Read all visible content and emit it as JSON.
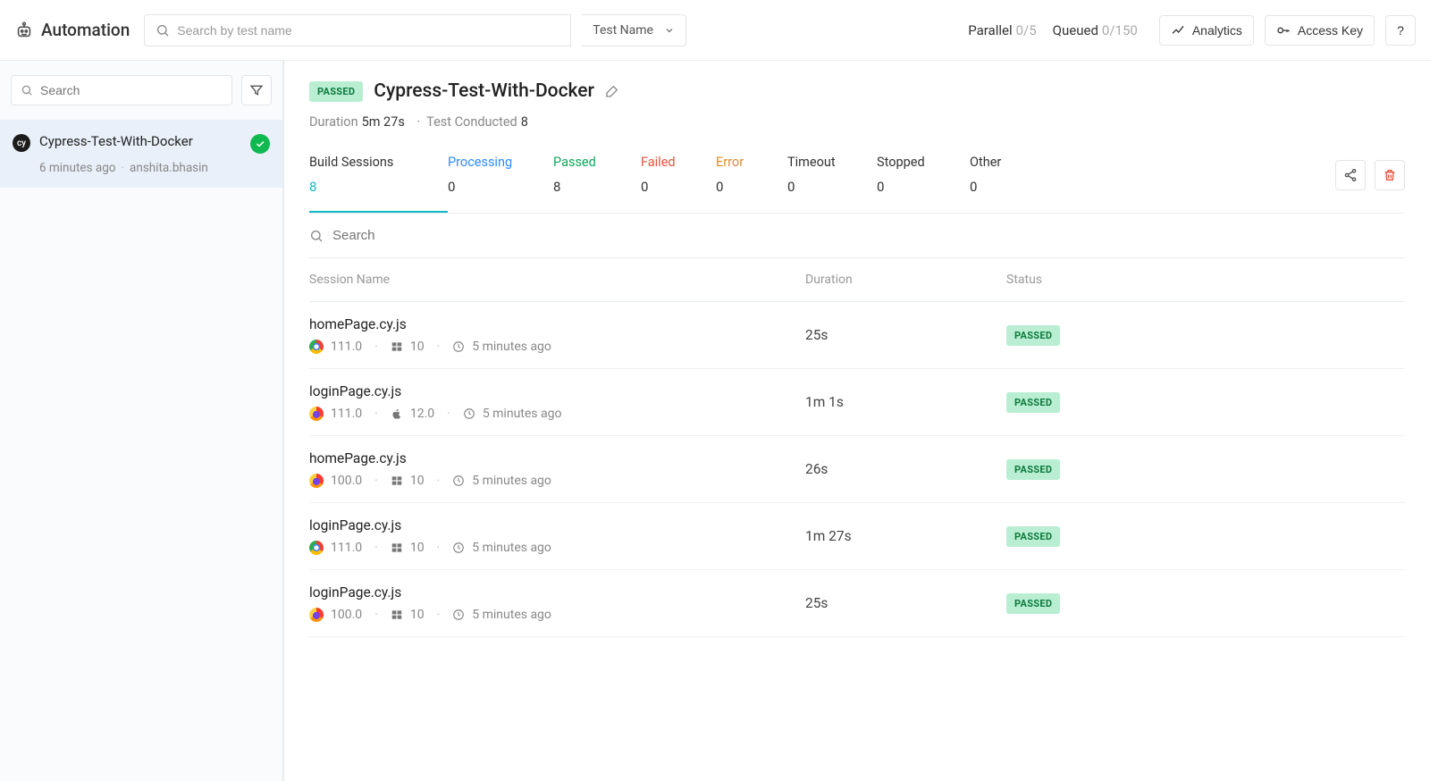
{
  "header": {
    "brand": "Automation",
    "search_placeholder": "Search by test name",
    "dropdown_label": "Test Name",
    "parallel_label": "Parallel",
    "parallel_value": "0/5",
    "queued_label": "Queued",
    "queued_value": "0/150",
    "analytics_label": "Analytics",
    "access_key_label": "Access Key",
    "help_label": "?"
  },
  "sidebar": {
    "search_placeholder": "Search",
    "items": [
      {
        "badge": "cy",
        "name": "Cypress-Test-With-Docker",
        "time": "6 minutes ago",
        "user": "anshita.bhasin",
        "status": "passed"
      }
    ]
  },
  "build": {
    "status_badge": "PASSED",
    "title": "Cypress-Test-With-Docker",
    "duration_label": "Duration",
    "duration_value": "5m 27s",
    "tests_label": "Test Conducted",
    "tests_value": "8"
  },
  "stats": [
    {
      "label": "Build Sessions",
      "value": "8",
      "color": "teal",
      "label_color": "default",
      "active": true
    },
    {
      "label": "Processing",
      "value": "0",
      "color": "default",
      "label_color": "blue"
    },
    {
      "label": "Passed",
      "value": "8",
      "color": "default",
      "label_color": "green"
    },
    {
      "label": "Failed",
      "value": "0",
      "color": "default",
      "label_color": "red"
    },
    {
      "label": "Error",
      "value": "0",
      "color": "default",
      "label_color": "orange"
    },
    {
      "label": "Timeout",
      "value": "0",
      "color": "default",
      "label_color": "default"
    },
    {
      "label": "Stopped",
      "value": "0",
      "color": "default",
      "label_color": "default"
    },
    {
      "label": "Other",
      "value": "0",
      "color": "default",
      "label_color": "default"
    }
  ],
  "session_search_placeholder": "Search",
  "table": {
    "col_name": "Session Name",
    "col_duration": "Duration",
    "col_status": "Status"
  },
  "sessions": [
    {
      "name": "homePage.cy.js",
      "browser": "chrome",
      "browser_version": "111.0",
      "os": "windows",
      "os_version": "10",
      "time": "5 minutes ago",
      "duration": "25s",
      "status": "PASSED"
    },
    {
      "name": "loginPage.cy.js",
      "browser": "firefox",
      "browser_version": "111.0",
      "os": "apple",
      "os_version": "12.0",
      "time": "5 minutes ago",
      "duration": "1m 1s",
      "status": "PASSED"
    },
    {
      "name": "homePage.cy.js",
      "browser": "firefox",
      "browser_version": "100.0",
      "os": "windows",
      "os_version": "10",
      "time": "5 minutes ago",
      "duration": "26s",
      "status": "PASSED"
    },
    {
      "name": "loginPage.cy.js",
      "browser": "chrome",
      "browser_version": "111.0",
      "os": "windows",
      "os_version": "10",
      "time": "5 minutes ago",
      "duration": "1m 27s",
      "status": "PASSED"
    },
    {
      "name": "loginPage.cy.js",
      "browser": "firefox",
      "browser_version": "100.0",
      "os": "windows",
      "os_version": "10",
      "time": "5 minutes ago",
      "duration": "25s",
      "status": "PASSED"
    }
  ]
}
